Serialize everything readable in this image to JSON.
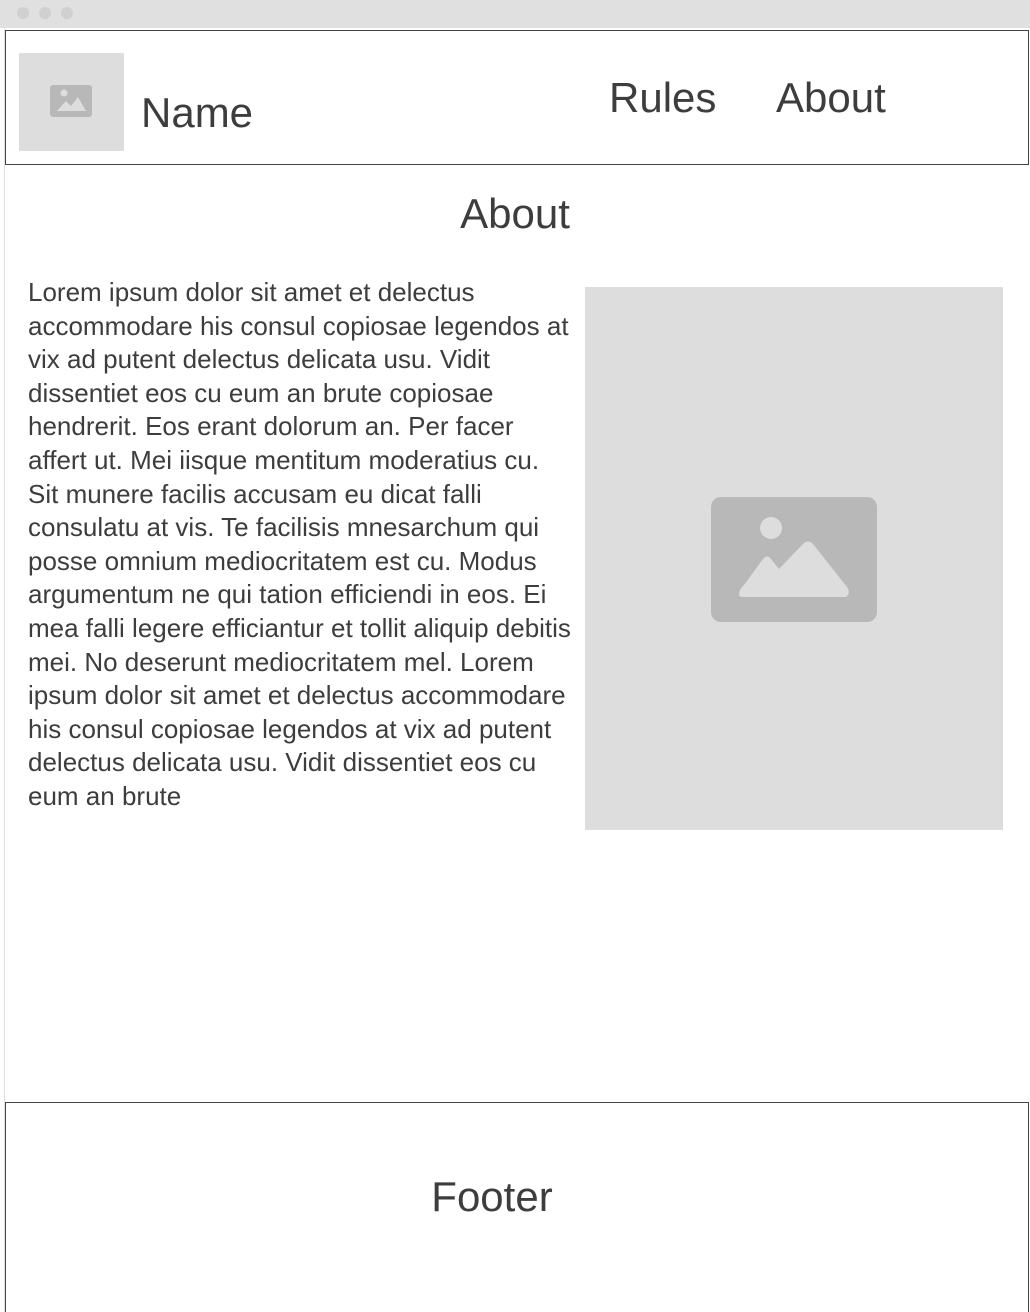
{
  "header": {
    "logo_icon": "image-placeholder-icon",
    "site_name": "Name",
    "nav": [
      {
        "label": "Rules"
      },
      {
        "label": "About"
      }
    ]
  },
  "main": {
    "title": "About",
    "body": "Lorem ipsum dolor sit amet et delectus accommodare his consul copiosae legendos at vix ad putent delectus delicata usu. Vidit dissentiet eos cu eum an brute copiosae hendrerit. Eos erant dolorum an. Per facer affert ut. Mei iisque mentitum moderatius cu. Sit munere facilis accusam eu dicat falli consulatu at vis. Te facilisis mnesarchum qui posse omnium mediocritatem est cu. Modus argumentum ne qui tation efficiendi in eos. Ei mea falli legere efficiantur et tollit aliquip debitis mei. No deserunt mediocritatem mel. Lorem ipsum dolor sit amet et delectus accommodare his consul copiosae legendos at vix ad putent delectus delicata usu. Vidit dissentiet eos cu eum an brute",
    "image_icon": "image-placeholder-icon"
  },
  "footer": {
    "label": "Footer"
  },
  "colors": {
    "placeholder_bg": "#dddddd",
    "placeholder_icon": "#b8b8b8",
    "text": "#3d3d3d",
    "border": "#444444"
  }
}
